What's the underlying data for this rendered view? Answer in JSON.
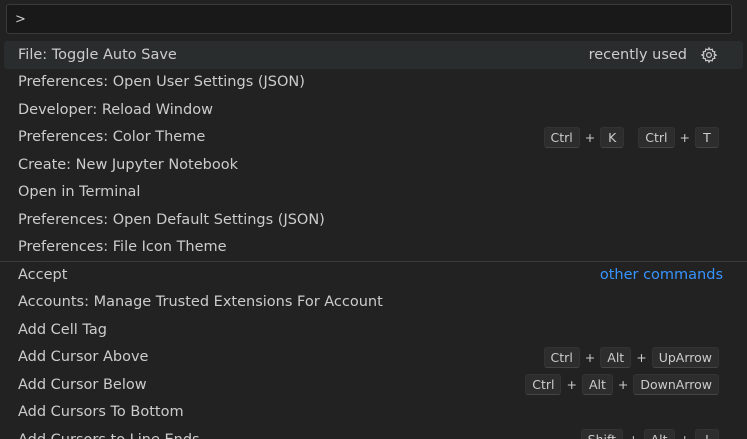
{
  "search": {
    "value": ">",
    "placeholder": ""
  },
  "items": [
    {
      "label": "File: Toggle Auto Save",
      "badge": "recently used",
      "icon": "gear-icon",
      "selected": true
    },
    {
      "label": "Preferences: Open User Settings (JSON)"
    },
    {
      "label": "Developer: Reload Window"
    },
    {
      "label": "Preferences: Color Theme",
      "keys": [
        [
          "Ctrl",
          "K"
        ],
        [
          "Ctrl",
          "T"
        ]
      ]
    },
    {
      "label": "Create: New Jupyter Notebook"
    },
    {
      "label": "Open in Terminal"
    },
    {
      "label": "Preferences: Open Default Settings (JSON)"
    },
    {
      "label": "Preferences: File Icon Theme"
    },
    {
      "label": "Accept",
      "link": "other commands",
      "separator": true
    },
    {
      "label": "Accounts: Manage Trusted Extensions For Account"
    },
    {
      "label": "Add Cell Tag"
    },
    {
      "label": "Add Cursor Above",
      "keys": [
        [
          "Ctrl",
          "Alt",
          "UpArrow"
        ]
      ]
    },
    {
      "label": "Add Cursor Below",
      "keys": [
        [
          "Ctrl",
          "Alt",
          "DownArrow"
        ]
      ]
    },
    {
      "label": "Add Cursors To Bottom"
    },
    {
      "label": "Add Cursors to Line Ends",
      "keys": [
        [
          "Shift",
          "Alt",
          "I"
        ]
      ]
    }
  ],
  "colors": {
    "background": "#222222",
    "selected": "#2a2d2e",
    "link": "#3794ff",
    "text": "#cccccc"
  }
}
